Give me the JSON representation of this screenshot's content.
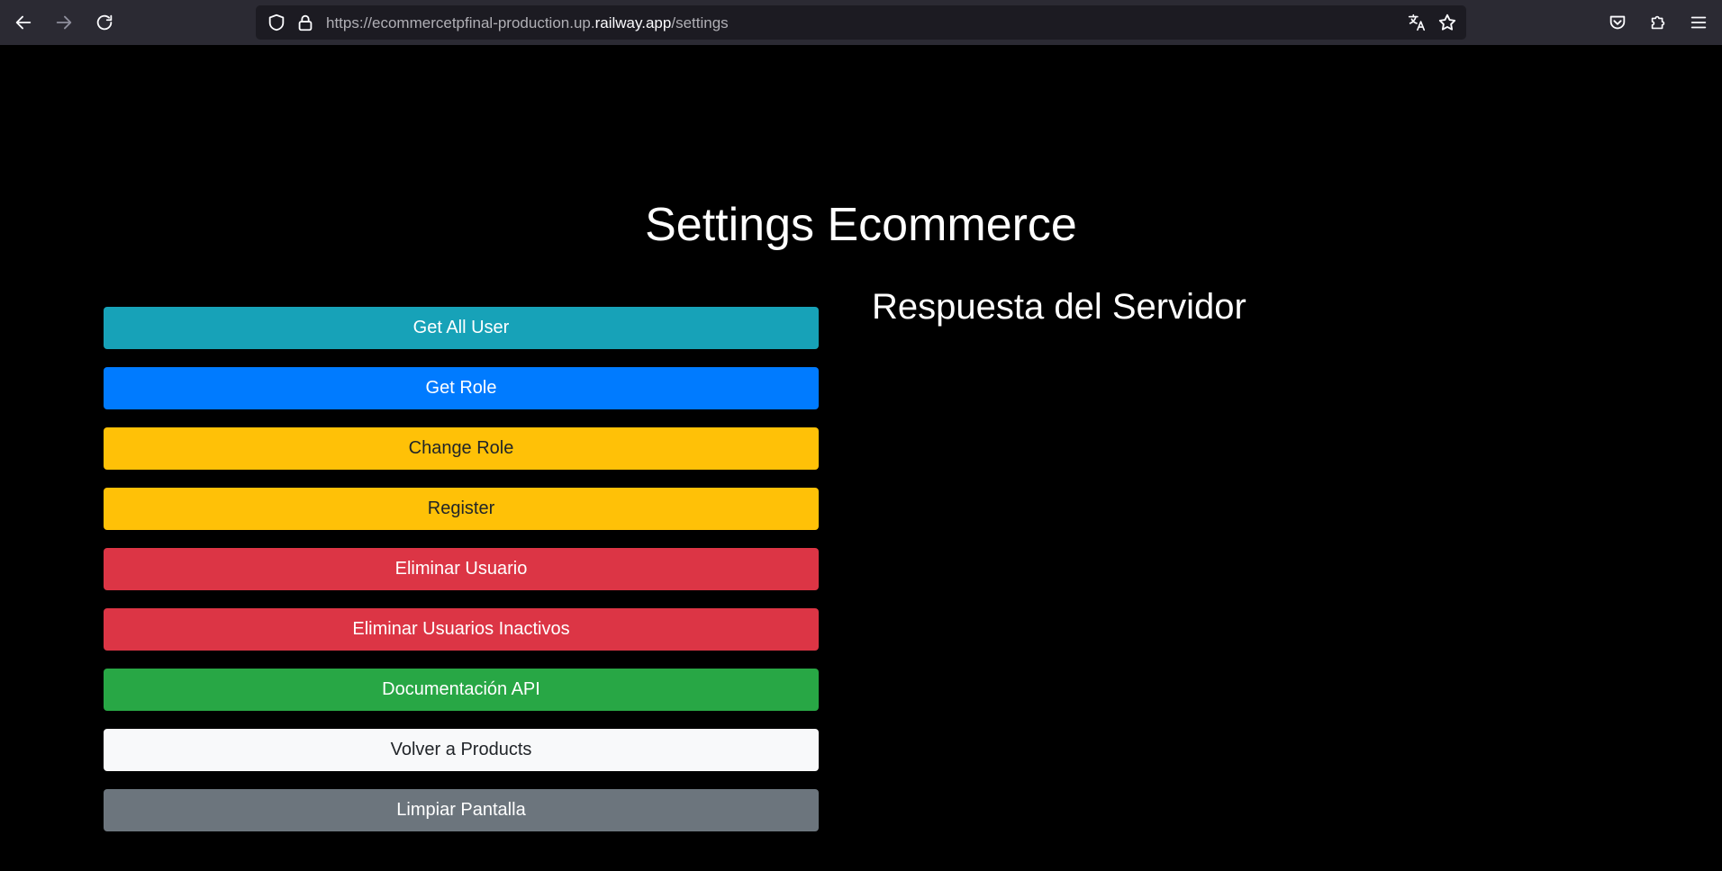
{
  "browser": {
    "url_prefix": "https://ecommercetpfinal-production.up.",
    "url_domain": "railway.app",
    "url_path": "/settings",
    "icons": {
      "back": "arrow-left-icon",
      "forward": "arrow-right-icon",
      "reload": "reload-icon",
      "tracking": "shield-icon",
      "security": "lock-icon",
      "translate": "translate-icon",
      "bookmark": "star-icon",
      "pocket": "pocket-icon",
      "extensions": "puzzle-icon",
      "menu": "hamburger-menu-icon"
    }
  },
  "page": {
    "title": "Settings Ecommerce",
    "response_title": "Respuesta del Servidor"
  },
  "buttons": [
    {
      "label": "Get All User",
      "color": "#17a2b8"
    },
    {
      "label": "Get Role",
      "color": "#007bff"
    },
    {
      "label": "Change Role",
      "color": "#ffc107"
    },
    {
      "label": "Register",
      "color": "#ffc107"
    },
    {
      "label": "Eliminar Usuario",
      "color": "#dc3545"
    },
    {
      "label": "Eliminar Usuarios Inactivos",
      "color": "#dc3545"
    },
    {
      "label": "Documentación API",
      "color": "#28a745"
    },
    {
      "label": "Volver a Products",
      "color": "#f8f9fa"
    },
    {
      "label": "Limpiar Pantalla",
      "color": "#6c757d"
    }
  ]
}
